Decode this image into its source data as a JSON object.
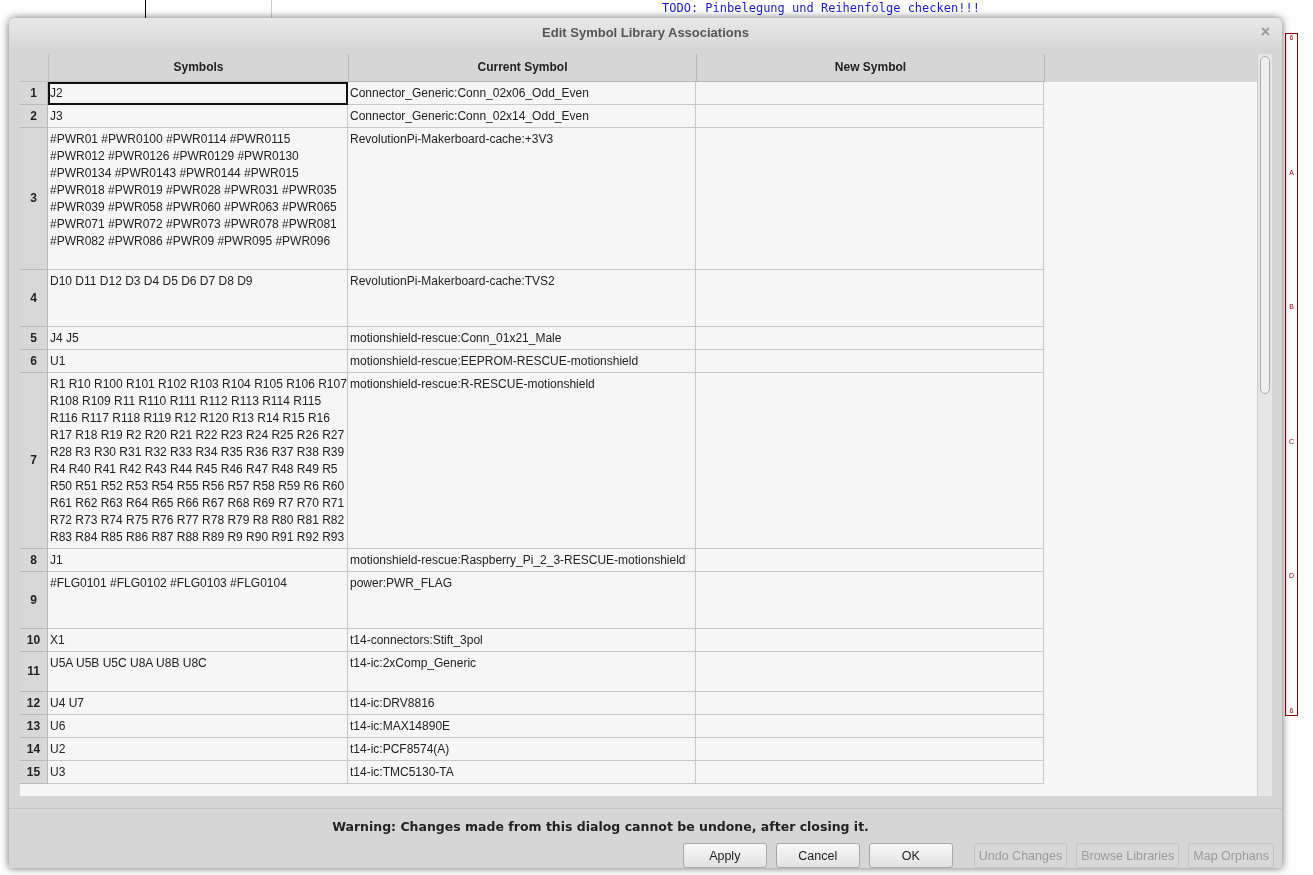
{
  "background": {
    "note": "TODO: Pinbelegung und Reihenfolge checken!!!",
    "frame_labels": [
      "6",
      "A",
      "B",
      "C",
      "D",
      "6"
    ]
  },
  "dialog": {
    "title": "Edit Symbol Library Associations",
    "close": "×"
  },
  "table": {
    "columns": [
      "Symbols",
      "Current Symbol",
      "New Symbol"
    ],
    "rows": [
      {
        "number": "1",
        "symbols": "J2",
        "current": "Connector_Generic:Conn_02x06_Odd_Even",
        "selected": true
      },
      {
        "number": "2",
        "symbols": "J3",
        "current": "Connector_Generic:Conn_02x14_Odd_Even",
        "selected": false
      },
      {
        "number": "3",
        "symbols": "#PWR01 #PWR0100 #PWR0114 #PWR0115\n#PWR012 #PWR0126 #PWR0129 #PWR0130\n#PWR0134 #PWR0143 #PWR0144 #PWR015\n#PWR018 #PWR019 #PWR028 #PWR031 #PWR035\n#PWR039 #PWR058 #PWR060 #PWR063 #PWR065\n#PWR071 #PWR072 #PWR073 #PWR078 #PWR081\n#PWR082 #PWR086 #PWR09 #PWR095 #PWR096",
        "current": "RevolutionPi-Makerboard-cache:+3V3",
        "selected": false
      },
      {
        "number": "4",
        "symbols": "D10 D11 D12 D3 D4 D5 D6 D7 D8 D9",
        "current": "RevolutionPi-Makerboard-cache:TVS2",
        "selected": false
      },
      {
        "number": "5",
        "symbols": "J4 J5",
        "current": "motionshield-rescue:Conn_01x21_Male",
        "selected": false
      },
      {
        "number": "6",
        "symbols": "U1",
        "current": "motionshield-rescue:EEPROM-RESCUE-motionshield",
        "selected": false
      },
      {
        "number": "7",
        "symbols": "R1 R10 R100 R101 R102 R103 R104 R105 R106 R107\nR108 R109 R11 R110 R111 R112 R113 R114 R115\nR116 R117 R118 R119 R12 R120 R13 R14 R15 R16\nR17 R18 R19 R2 R20 R21 R22 R23 R24 R25 R26 R27\nR28 R3 R30 R31 R32 R33 R34 R35 R36 R37 R38 R39\nR4 R40 R41 R42 R43 R44 R45 R46 R47 R48 R49 R5\nR50 R51 R52 R53 R54 R55 R56 R57 R58 R59 R6 R60\nR61 R62 R63 R64 R65 R66 R67 R68 R69 R7 R70 R71\nR72 R73 R74 R75 R76 R77 R78 R79 R8 R80 R81 R82\nR83 R84 R85 R86 R87 R88 R89 R9 R90 R91 R92 R93",
        "current": "motionshield-rescue:R-RESCUE-motionshield",
        "selected": false
      },
      {
        "number": "8",
        "symbols": "J1",
        "current": "motionshield-rescue:Raspberry_Pi_2_3-RESCUE-motionshield",
        "selected": false
      },
      {
        "number": "9",
        "symbols": "#FLG0101 #FLG0102 #FLG0103 #FLG0104",
        "current": "power:PWR_FLAG",
        "selected": false
      },
      {
        "number": "10",
        "symbols": "X1",
        "current": "t14-connectors:Stift_3pol",
        "selected": false
      },
      {
        "number": "11",
        "symbols": "U5A U5B U5C U8A U8B U8C",
        "current": "t14-ic:2xComp_Generic",
        "selected": false
      },
      {
        "number": "12",
        "symbols": "U4 U7",
        "current": "t14-ic:DRV8816",
        "selected": false
      },
      {
        "number": "13",
        "symbols": "U6",
        "current": "t14-ic:MAX14890E",
        "selected": false
      },
      {
        "number": "14",
        "symbols": "U2",
        "current": "t14-ic:PCF8574(A)",
        "selected": false
      },
      {
        "number": "15",
        "symbols": "U3",
        "current": "t14-ic:TMC5130-TA",
        "selected": false
      }
    ]
  },
  "warning": "Warning: Changes made from this dialog cannot be undone, after closing it.",
  "buttons": [
    {
      "label": "Apply",
      "disabled": false
    },
    {
      "label": "Cancel",
      "disabled": false
    },
    {
      "label": "OK",
      "disabled": false
    },
    {
      "label": "Undo Changes",
      "disabled": true
    },
    {
      "label": "Browse Libraries",
      "disabled": true
    },
    {
      "label": "Map Orphans",
      "disabled": true
    }
  ]
}
